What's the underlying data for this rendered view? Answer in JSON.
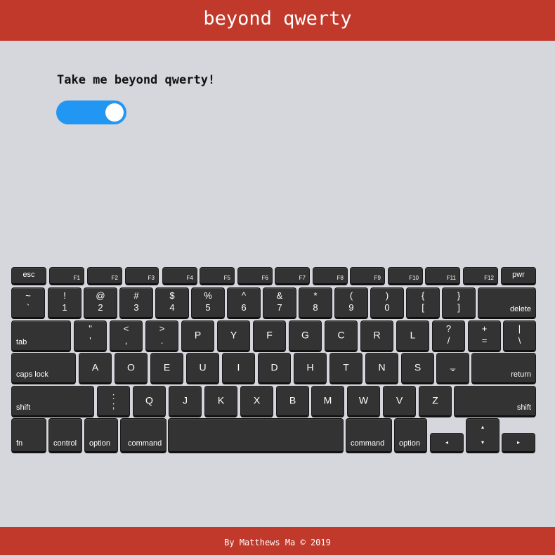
{
  "header": {
    "title": "beyond qwerty"
  },
  "prompt": {
    "text": "Take me beyond qwerty!"
  },
  "toggle": {
    "state": "on",
    "accent": "#2196f3"
  },
  "colors": {
    "brand": "#c0392b",
    "key": "#333333",
    "background": "#d5d7dc"
  },
  "keyboard": {
    "fn_row": [
      {
        "t": "esc"
      },
      {
        "t": "F1"
      },
      {
        "t": "F2"
      },
      {
        "t": "F3"
      },
      {
        "t": "F4"
      },
      {
        "t": "F5"
      },
      {
        "t": "F6"
      },
      {
        "t": "F7"
      },
      {
        "t": "F8"
      },
      {
        "t": "F9"
      },
      {
        "t": "F10"
      },
      {
        "t": "F11"
      },
      {
        "t": "F12"
      },
      {
        "t": "pwr"
      }
    ],
    "number_row": [
      {
        "top": "~",
        "bot": "`"
      },
      {
        "top": "!",
        "bot": "1"
      },
      {
        "top": "@",
        "bot": "2"
      },
      {
        "top": "#",
        "bot": "3"
      },
      {
        "top": "$",
        "bot": "4"
      },
      {
        "top": "%",
        "bot": "5"
      },
      {
        "top": "^",
        "bot": "6"
      },
      {
        "top": "&",
        "bot": "7"
      },
      {
        "top": "*",
        "bot": "8"
      },
      {
        "top": "(",
        "bot": "9"
      },
      {
        "top": ")",
        "bot": "0"
      },
      {
        "top": "{",
        "bot": "["
      },
      {
        "top": "}",
        "bot": "]"
      },
      {
        "t": "delete"
      }
    ],
    "top_row": [
      {
        "t": "tab"
      },
      {
        "top": "\"",
        "bot": "'"
      },
      {
        "top": "<",
        "bot": ","
      },
      {
        "top": ">",
        "bot": "."
      },
      {
        "t": "P"
      },
      {
        "t": "Y"
      },
      {
        "t": "F"
      },
      {
        "t": "G"
      },
      {
        "t": "C"
      },
      {
        "t": "R"
      },
      {
        "t": "L"
      },
      {
        "top": "?",
        "bot": "/"
      },
      {
        "top": "+",
        "bot": "="
      },
      {
        "top": "|",
        "bot": "\\"
      }
    ],
    "home_row": [
      {
        "t": "caps lock"
      },
      {
        "t": "A"
      },
      {
        "t": "O"
      },
      {
        "t": "E"
      },
      {
        "t": "U"
      },
      {
        "t": "I"
      },
      {
        "t": "D"
      },
      {
        "t": "H"
      },
      {
        "t": "T"
      },
      {
        "t": "N"
      },
      {
        "t": "S"
      },
      {
        "top": "_",
        "bot": "-"
      },
      {
        "t": "return"
      }
    ],
    "bottom_row": [
      {
        "t": "shift"
      },
      {
        "top": ":",
        "bot": ";"
      },
      {
        "t": "Q"
      },
      {
        "t": "J"
      },
      {
        "t": "K"
      },
      {
        "t": "X"
      },
      {
        "t": "B"
      },
      {
        "t": "M"
      },
      {
        "t": "W"
      },
      {
        "t": "V"
      },
      {
        "t": "Z"
      },
      {
        "t": "shift"
      }
    ],
    "modifier_row": [
      {
        "t": "fn"
      },
      {
        "t": "control"
      },
      {
        "t": "option"
      },
      {
        "t": "command"
      },
      {
        "t": ""
      },
      {
        "t": "command"
      },
      {
        "t": "option"
      },
      {
        "t": "◂"
      },
      {
        "t": "▴"
      },
      {
        "t": "▾"
      },
      {
        "t": "▸"
      }
    ]
  },
  "footer": {
    "text": "By Matthews Ma © 2019"
  }
}
